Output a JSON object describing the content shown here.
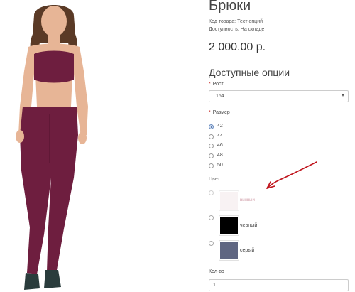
{
  "product": {
    "title": "Брюки",
    "code_line": "Код товара: Тест опций",
    "availability_line": "Доступность: На складе",
    "price": "2 000.00 р.",
    "photo_caption": "",
    "photo_colors": {
      "clothing": "#6e1e3f",
      "skin": "#e7b596",
      "hair": "#5a3a26",
      "shoe": "#2a3c3c"
    }
  },
  "options": {
    "heading": "Доступные опции",
    "required_mark": "*",
    "height": {
      "label": "Рост",
      "selected": "164"
    },
    "size": {
      "label": "Размер",
      "choices": [
        {
          "value": "42",
          "checked": true
        },
        {
          "value": "44",
          "checked": false
        },
        {
          "value": "46",
          "checked": false
        },
        {
          "value": "48",
          "checked": false
        },
        {
          "value": "50",
          "checked": false
        }
      ]
    },
    "color": {
      "label": "Цвет",
      "choices": [
        {
          "name": "винный",
          "swatch": "#f3e8ea",
          "available": false
        },
        {
          "name": "черный",
          "swatch": "#000000",
          "available": true
        },
        {
          "name": "серый",
          "swatch": "#5f6682",
          "available": true
        }
      ]
    }
  },
  "quantity": {
    "label": "Кол-во",
    "value": "1"
  },
  "annotation": {
    "arrow_color": "#c0141c"
  }
}
